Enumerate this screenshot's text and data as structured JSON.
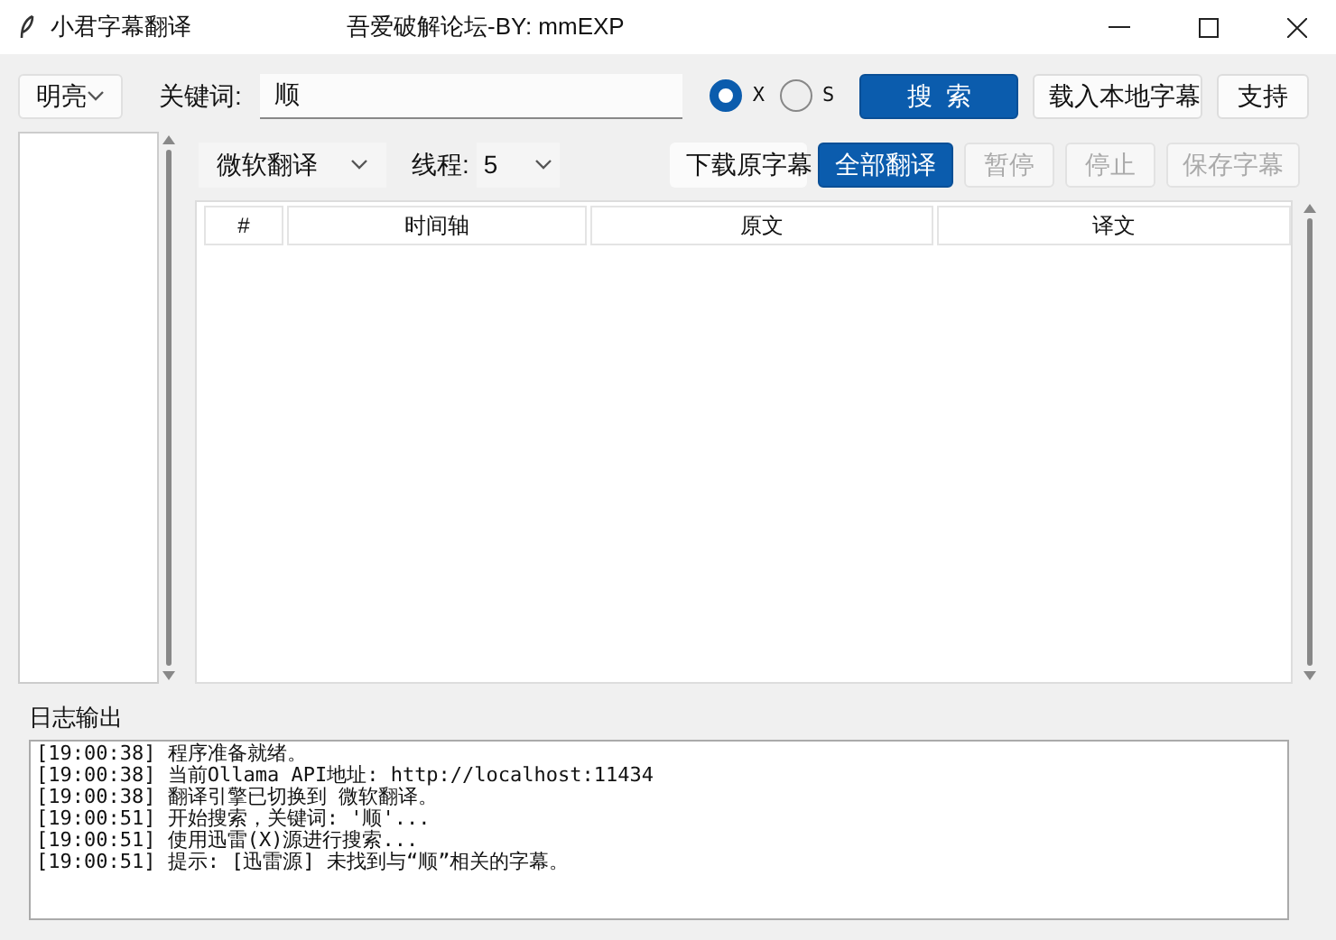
{
  "window": {
    "title": "小君字幕翻译",
    "subtitle": "吾爱破解论坛-BY: mmEXP"
  },
  "toolbar": {
    "theme": "明亮",
    "keyword_label": "关键词:",
    "keyword": "顺",
    "sources": [
      {
        "label": "X",
        "selected": true
      },
      {
        "label": "S",
        "selected": false
      }
    ],
    "buttons": [
      {
        "label": "搜  索",
        "kind": "primary",
        "disabled": false
      },
      {
        "label": "载入本地字幕",
        "kind": "normal",
        "disabled": false
      },
      {
        "label": "支持",
        "kind": "normal",
        "disabled": false
      }
    ]
  },
  "controls": {
    "engine": "微软翻译",
    "threads_label": "线程:",
    "threads": "5",
    "buttons": [
      {
        "label": "下载原字幕",
        "kind": "normal",
        "disabled": false
      },
      {
        "label": "全部翻译",
        "kind": "primary",
        "disabled": false
      },
      {
        "label": "暂停",
        "kind": "normal",
        "disabled": true
      },
      {
        "label": "停止",
        "kind": "normal",
        "disabled": true
      },
      {
        "label": "保存字幕",
        "kind": "normal",
        "disabled": true
      }
    ]
  },
  "table": {
    "columns": [
      "#",
      "时间轴",
      "原文",
      "译文"
    ]
  },
  "log": {
    "title": "日志输出",
    "lines": [
      "[19:00:38] 程序准备就绪。",
      "[19:00:38] 当前Ollama API地址: http://localhost:11434",
      "[19:00:38] 翻译引擎已切换到 微软翻译。",
      "[19:00:51] 开始搜索，关键词: '顺'...",
      "[19:00:51] 使用迅雷(X)源进行搜索...",
      "[19:00:51] 提示: [迅雷源] 未找到与“顺”相关的字幕。"
    ]
  }
}
